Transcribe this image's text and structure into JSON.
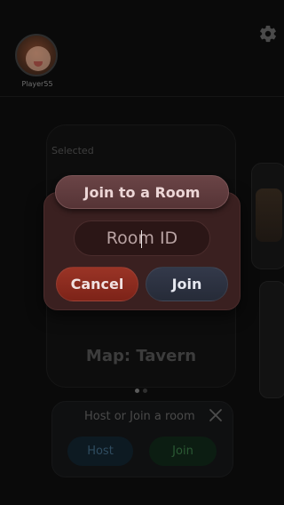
{
  "profile": {
    "player_name": "Player55"
  },
  "icons": {
    "settings": "gear-icon",
    "close": "close-icon"
  },
  "map_card": {
    "selected_label": "Selected",
    "map_title": "Map: Tavern"
  },
  "carousel": {
    "pages": 2,
    "active_index": 0
  },
  "host_panel": {
    "title": "Host or Join a room",
    "host_label": "Host",
    "join_label": "Join"
  },
  "join_dialog": {
    "title": "Join to a Room",
    "room_id_placeholder": "Room ID",
    "room_id_value": "",
    "cancel_label": "Cancel",
    "join_label": "Join"
  },
  "colors": {
    "cancel": "#8b2b1f",
    "join": "#2c3240",
    "dialog": "#3a2020"
  }
}
